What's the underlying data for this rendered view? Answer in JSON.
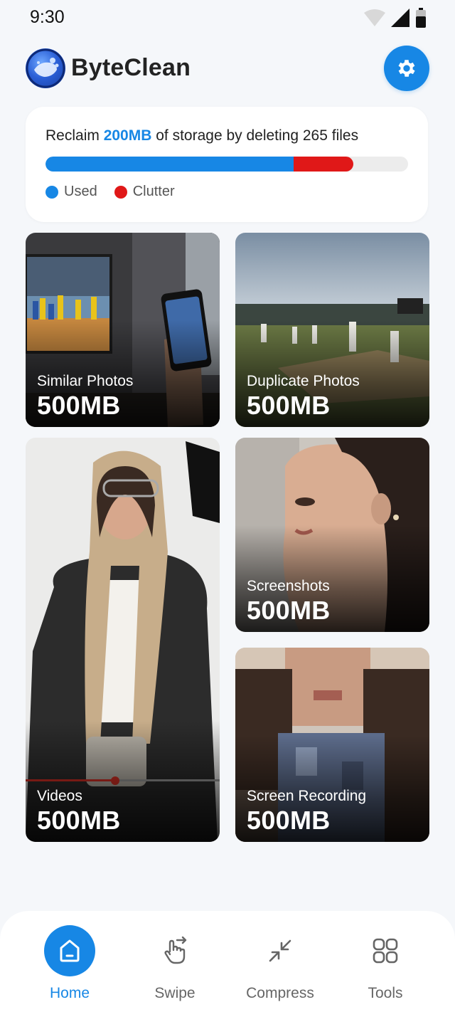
{
  "status_bar": {
    "time": "9:30",
    "icons": [
      "wifi-icon",
      "signal-icon",
      "battery-icon"
    ]
  },
  "header": {
    "app_name": "ByteClean",
    "logo": "app-logo-icon",
    "settings_icon": "gear-icon"
  },
  "storage": {
    "text_prefix": "Reclaim ",
    "highlight": "200MB",
    "text_suffix": " of storage by deleting 265 files",
    "used_fraction": 0.685,
    "clutter_fraction": 0.165,
    "legend": [
      {
        "label": "Used",
        "color": "#1787e5"
      },
      {
        "label": "Clutter",
        "color": "#e01818"
      }
    ]
  },
  "categories": [
    {
      "label": "Similar Photos",
      "size": "500MB"
    },
    {
      "label": "Duplicate Photos",
      "size": "500MB"
    },
    {
      "label": "Videos",
      "size": "500MB"
    },
    {
      "label": "Screenshots",
      "size": "500MB"
    },
    {
      "label": "Screen Recording",
      "size": "500MB"
    }
  ],
  "nav": [
    {
      "label": "Home",
      "icon": "home-icon",
      "active": true
    },
    {
      "label": "Swipe",
      "icon": "swipe-hand-icon",
      "active": false
    },
    {
      "label": "Compress",
      "icon": "compress-arrows-icon",
      "active": false
    },
    {
      "label": "Tools",
      "icon": "grid-tools-icon",
      "active": false
    }
  ],
  "colors": {
    "accent": "#1787e5",
    "clutter": "#e01818",
    "background": "#f5f7fa"
  }
}
